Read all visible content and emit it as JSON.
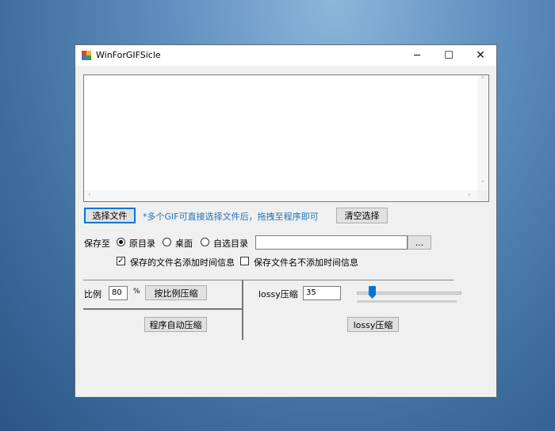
{
  "window": {
    "title": "WinForGIFSicle",
    "controls": {
      "minimize": "─",
      "maximize": "☐",
      "close": "✕"
    }
  },
  "scroll_arrows": {
    "up": "⌃",
    "down": "⌄",
    "left": "‹",
    "right": "›"
  },
  "file_select": {
    "button": "选择文件",
    "hint": "*多个GIF可直接选择文件后，拖拽至程序即可",
    "clear_button": "清空选择"
  },
  "save": {
    "label": "保存至",
    "options": [
      "原目录",
      "桌面",
      "自选目录"
    ],
    "selected": "原目录",
    "path_value": "",
    "browse_button": "...",
    "checkbox_timestamp": {
      "label": "保存的文件名添加时间信息",
      "checked": true
    },
    "checkbox_no_timestamp": {
      "label": "保存文件名不添加时间信息",
      "checked": false
    }
  },
  "ratio": {
    "label": "比例",
    "value": "80",
    "unit": "%",
    "compress_button": "按比例压缩",
    "auto_button": "程序自动压缩"
  },
  "lossy": {
    "label": "lossy压缩",
    "value": "35",
    "slider_level": 0.27,
    "compress_button": "lossy压缩"
  },
  "colors": {
    "hint": "#1e73b8",
    "accent": "#0078d7"
  }
}
